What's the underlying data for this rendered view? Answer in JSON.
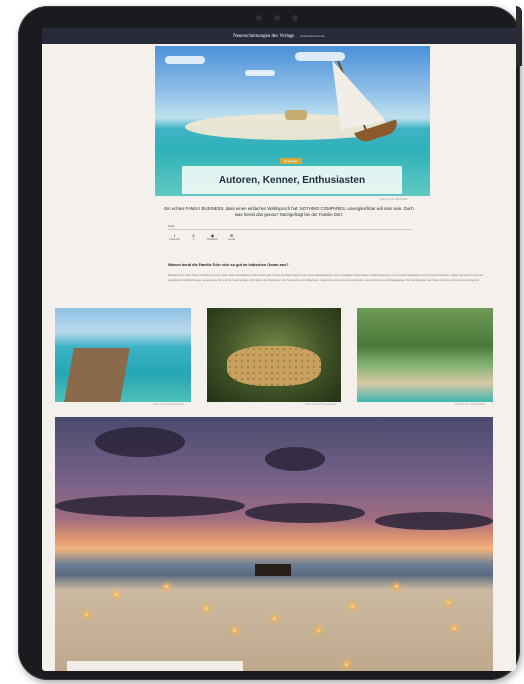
{
  "site": {
    "title": "Neuerscheinungen des Verlags",
    "subtitle": "deutschland heute"
  },
  "hero": {
    "badge": "Reportage",
    "title": "Autoren, Kenner, Enthusiasten",
    "credit": "Foto: Pexels / Maximilian"
  },
  "lead": "Ein echtes FAMILY BUSINESS, dass einen einfachen Wahlspruch hat: NOTHING COMPARES, unvergleichbar will man sein. Doch was heisst das genau? Nachgefragt bei der Familie Dörr.",
  "share": {
    "label": "Teilen",
    "items": [
      {
        "icon": "facebook-icon",
        "glyph": "f",
        "label": "Facebook"
      },
      {
        "icon": "x-icon",
        "glyph": "X",
        "label": "X"
      },
      {
        "icon": "whatsapp-icon",
        "glyph": "◉",
        "label": "WhatsApp"
      },
      {
        "icon": "mail-icon",
        "glyph": "✉",
        "label": "E-Mail"
      }
    ]
  },
  "article": {
    "question": "Warum berät die Familie Dörr sich so gut im Indischen Ozean aus?",
    "paragraph": "Ehepaar Dörr: Seit seiner Kindheit ist mein Vater leidenschaftlicher Weltenreisender und kennt diese Region wie seine Westentasche. Aus unzähligen Aufenthalten, 1990 begannen wir mit einem Reisebüro und Sehnsuchtsreisen, haben wir das Know-how aufgebaut und Erfahrungen gesammelt, die uns bis heute prägen. Wir lieben die Malediven, die Seychellen und Mauritius, zusammen mit der Insel La Réunion, den Komoren und Madagaskar. Die Kombination aus Natur, Kultur und Luxus ist einzigartig."
  },
  "gallery": {
    "credits": [
      "Foto: Pexels / Photographer",
      "Foto: Pexels / Photographer",
      "Foto: Pexels / Photographer"
    ]
  }
}
